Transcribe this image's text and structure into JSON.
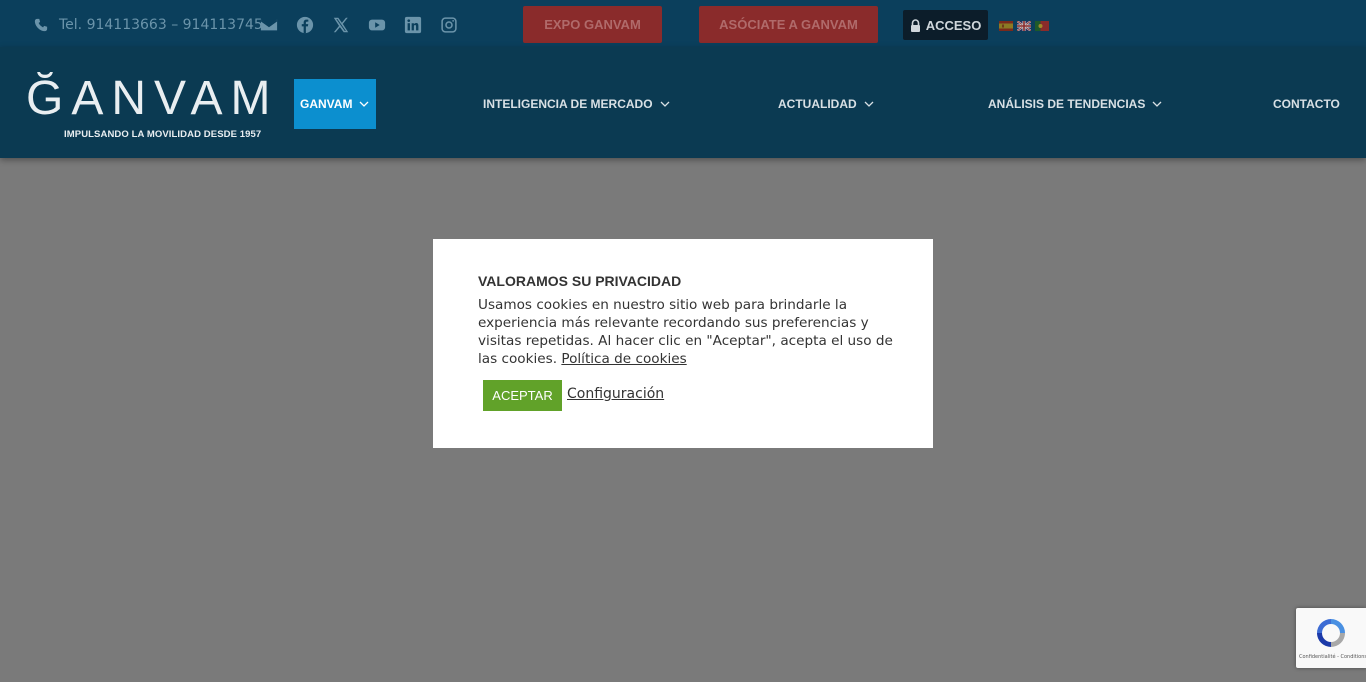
{
  "topbar": {
    "phone": "Tel. 914113663 – 914113745",
    "social_icons": [
      "envelope-icon",
      "facebook-icon",
      "x-icon",
      "youtube-icon",
      "linkedin-icon",
      "instagram-icon"
    ],
    "expo_label": "EXPO GANVAM",
    "asociate_label": "ASÓCIATE A GANVAM",
    "acceso_label": "ACCESO",
    "flags": [
      "flag-es",
      "flag-en",
      "flag-pt"
    ]
  },
  "header": {
    "logo_text": "ĞANVAM",
    "logo_tagline": "IMPULSANDO LA MOVILIDAD DESDE 1957",
    "nav": [
      {
        "label": "GANVAM",
        "active": true,
        "dropdown": true
      },
      {
        "label": "INTELIGENCIA DE MERCADO",
        "dropdown": true
      },
      {
        "label": "ACTUALIDAD",
        "dropdown": true
      },
      {
        "label": "ANÁLISIS DE TENDENCIAS",
        "dropdown": true
      },
      {
        "label": "CONTACTO",
        "dropdown": false
      }
    ]
  },
  "cookie_modal": {
    "title": "VALORAMOS SU PRIVACIDAD",
    "body": "Usamos cookies en nuestro sitio web para brindarle la experiencia más relevante recordando sus preferencias y visitas repetidas. Al hacer clic en \"Aceptar\", acepta el uso de las cookies.",
    "policy_link": "Política de cookies",
    "accept_label": "ACEPTAR",
    "config_label": "Configuración"
  },
  "recaptcha": {
    "links": "Confidentialité - Conditions"
  },
  "colors": {
    "topbar_bg": "#0b3f5c",
    "header_bg": "#0b3a52",
    "active_nav": "#0c8fcf",
    "accept_green": "#61a229",
    "overlay": "#7a7a7a"
  }
}
